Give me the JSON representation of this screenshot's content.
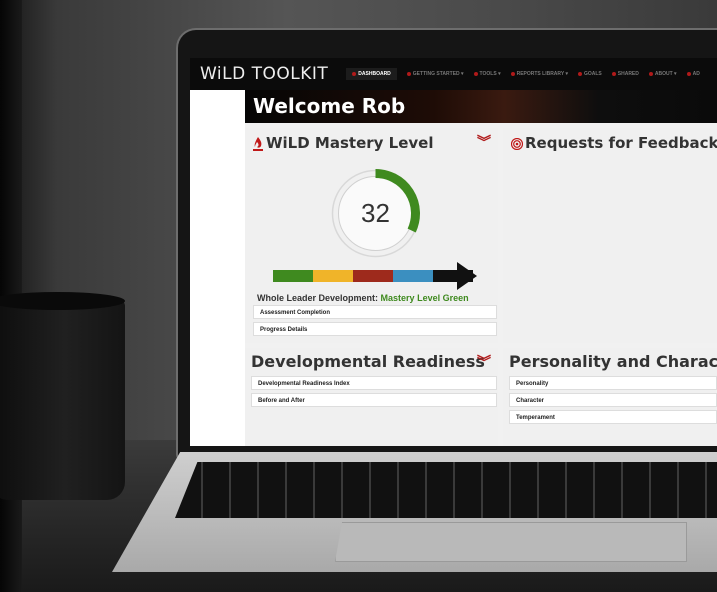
{
  "app": {
    "logo": "WiLD TOOLKIT",
    "nav": [
      {
        "label": "DASHBOARD",
        "active": true
      },
      {
        "label": "GETTING STARTED ▾",
        "active": false
      },
      {
        "label": "TOOLS ▾",
        "active": false
      },
      {
        "label": "REPORTS LIBRARY ▾",
        "active": false
      },
      {
        "label": "GOALS",
        "active": false
      },
      {
        "label": "SHARED",
        "active": false
      },
      {
        "label": "ABOUT ▾",
        "active": false
      },
      {
        "label": "AD",
        "active": false
      }
    ],
    "welcome": "Welcome Rob",
    "mastery": {
      "title": "WiLD Mastery Level",
      "score": "32",
      "score_fraction": 0.32,
      "summary_label": "Whole Leader Development:",
      "summary_value": "Mastery Level Green",
      "rows": [
        "Assessment Completion",
        "Progress Details"
      ],
      "bar_colors": [
        "#3f8a1f",
        "#f0b429",
        "#9e2a1c",
        "#3b8fc0",
        "#111111"
      ],
      "accent": "#3f8a1f"
    },
    "feedback": {
      "title": "Requests for Feedback"
    },
    "readiness": {
      "title": "Developmental Readiness",
      "rows": [
        "Developmental Readiness Index",
        "Before and After"
      ]
    },
    "personality": {
      "title": "Personality and Character",
      "rows": [
        "Personality",
        "Character",
        "Temperament"
      ]
    },
    "brand_red": "#b01a1a"
  }
}
